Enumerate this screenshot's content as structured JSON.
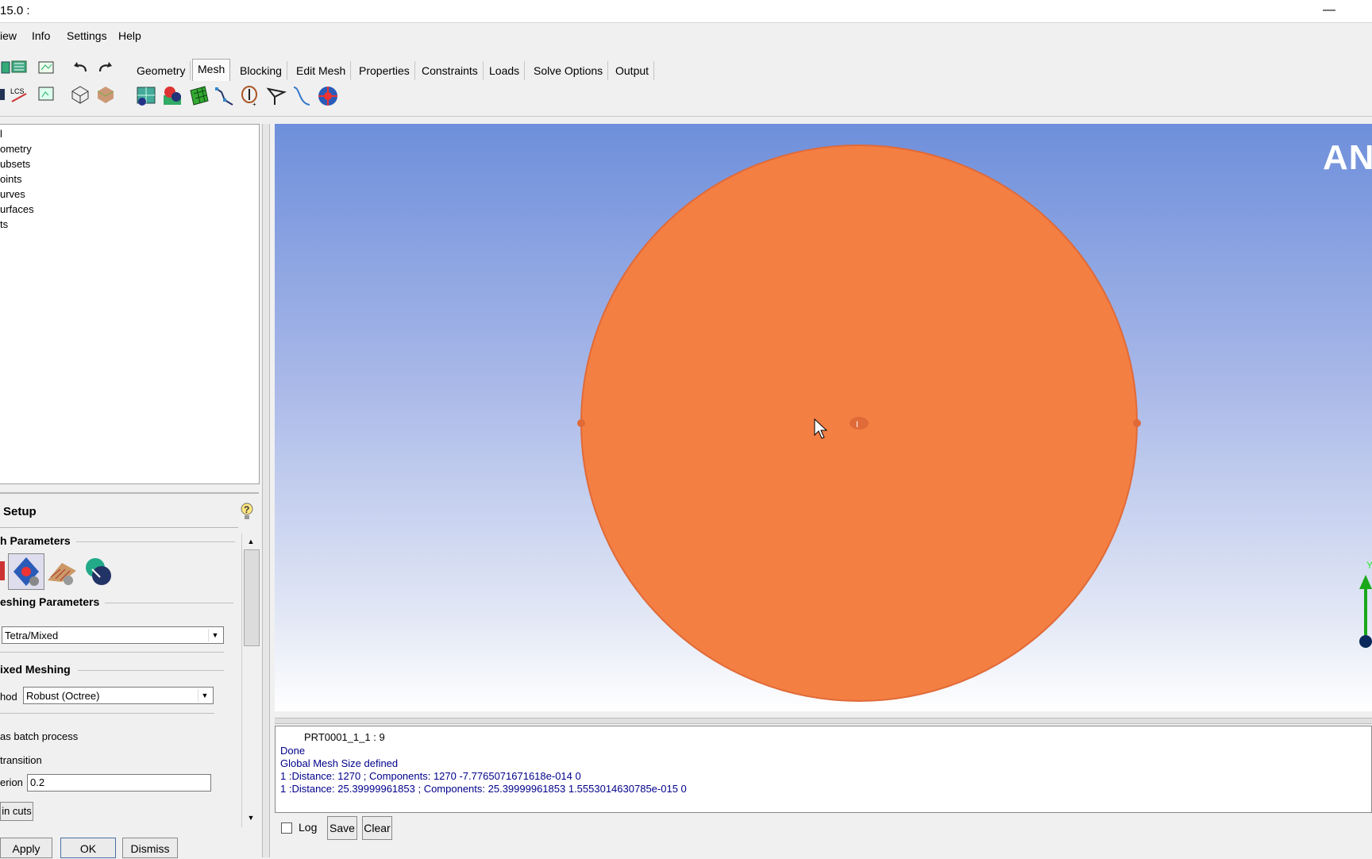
{
  "window": {
    "title": "15.0 :",
    "minimize_label": "—"
  },
  "menu": {
    "items": [
      "iew",
      "Info",
      "Settings",
      "Help"
    ]
  },
  "tabs": [
    "Geometry",
    "Mesh",
    "Blocking",
    "Edit Mesh",
    "Properties",
    "Constraints",
    "Loads",
    "Solve Options",
    "Output"
  ],
  "active_tab": "Mesh",
  "tree": {
    "items": [
      "l",
      "ometry",
      "ubsets",
      "oints",
      "urves",
      "urfaces",
      "ts"
    ]
  },
  "setup": {
    "title": "Setup",
    "section_params": "h Parameters",
    "section_meshing": "eshing Parameters",
    "mesh_type": "Tetra/Mixed",
    "section_mixed": "ixed Meshing",
    "method_label": "hod",
    "method_value": "Robust (Octree)",
    "batch_label": "as batch process",
    "transition_label": "transition",
    "criterion_label": "erion",
    "criterion_value": "0.2",
    "cuts_button": "in cuts"
  },
  "bottom_buttons": {
    "apply": "Apply",
    "ok": "OK",
    "dismiss": "Dismiss"
  },
  "viewport": {
    "brand": "ANS",
    "axis_label": "Y",
    "marker_label": "I",
    "disc_color": "#f47f43",
    "disc_edge_color": "#e06a38"
  },
  "console": {
    "title": "PRT0001_1_1 : 9",
    "lines": [
      "Done",
      "Global Mesh Size defined",
      "1 :Distance: 1270  ; Components:   1270 -7.7765071671618e-014 0",
      "1 :Distance: 25.39999961853  ; Components:   25.39999961853 1.5553014630785e-015 0"
    ],
    "log_label": "Log",
    "save_label": "Save",
    "clear_label": "Clear"
  }
}
